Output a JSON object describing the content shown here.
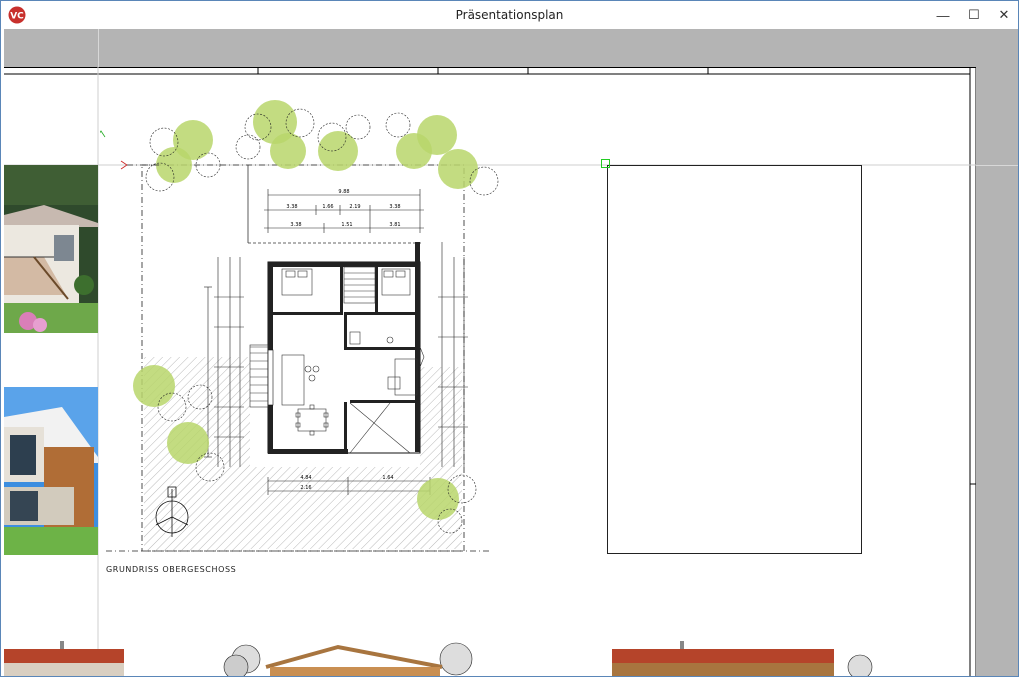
{
  "window": {
    "title": "Präsentationsplan",
    "buttons": {
      "minimize": "—",
      "maximize": "☐",
      "close": "✕"
    }
  },
  "app": {
    "logo_text": "VC"
  },
  "plan": {
    "caption": "GRUNDRISS OBERGESCHOSS",
    "dimensions": {
      "top_total": "9.88",
      "top_row1": [
        "3.38",
        "1.66",
        "2.19",
        "3.38"
      ],
      "top_row2": [
        "3.38",
        "1.51",
        "3.81"
      ],
      "bottom": [
        "4.84",
        "1.64",
        "2.16"
      ]
    }
  },
  "colors": {
    "titlebar": "#ffffff",
    "window_border": "#5a86b8",
    "canvas_gray": "#b4b4b4",
    "tree_green": "#b9d66b",
    "grid_red": "#cc2222",
    "grid_green": "#22aa22",
    "roof_red": "#b5442a",
    "facade_wood": "#a8753f"
  },
  "icons": [
    "app-logo-icon",
    "minimize-icon",
    "maximize-icon",
    "close-icon",
    "north-arrow-icon",
    "snap-point-icon",
    "tree-icon"
  ]
}
